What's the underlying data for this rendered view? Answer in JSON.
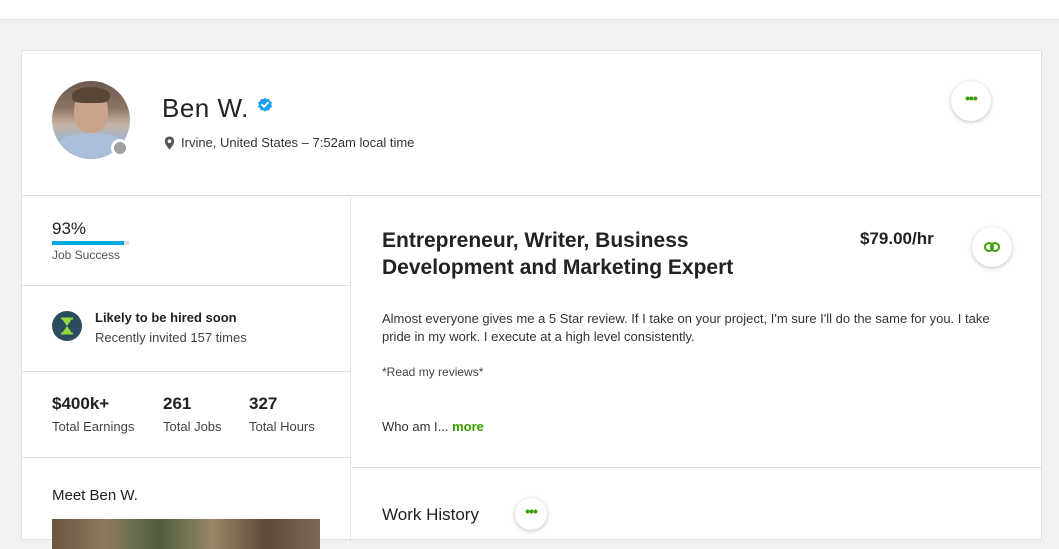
{
  "profile": {
    "name": "Ben W.",
    "location": "Irvine, United States – 7:52am local time"
  },
  "stats": {
    "job_success_value": "93%",
    "job_success_fraction": 0.93,
    "job_success_label": "Job Success",
    "hire_title": "Likely to be hired soon",
    "hire_subtitle": "Recently invited 157 times",
    "earnings_value": "$400k+",
    "earnings_label": "Total Earnings",
    "jobs_value": "261",
    "jobs_label": "Total Jobs",
    "hours_value": "327",
    "hours_label": "Total Hours"
  },
  "meet": {
    "title": "Meet Ben W."
  },
  "main": {
    "title": "Entrepreneur, Writer, Business Development and Marketing Expert",
    "rate": "$79.00/hr",
    "description": "Almost everyone gives me a 5 Star review. If I take on your project, I'm sure I'll do the same for you. I take pride in my work. I execute at a high level consistently.",
    "reviews_note": "*Read my reviews*",
    "who_text": "Who am I...",
    "more_label": "more",
    "work_history_title": "Work History"
  },
  "colors": {
    "accent_green": "#37a000",
    "job_success_blue": "#00a6e0",
    "verified_blue": "#1da1f2"
  },
  "icons": [
    "verified-badge-icon",
    "location-pin-icon",
    "more-options-icon",
    "hourglass-icon",
    "link-icon"
  ]
}
